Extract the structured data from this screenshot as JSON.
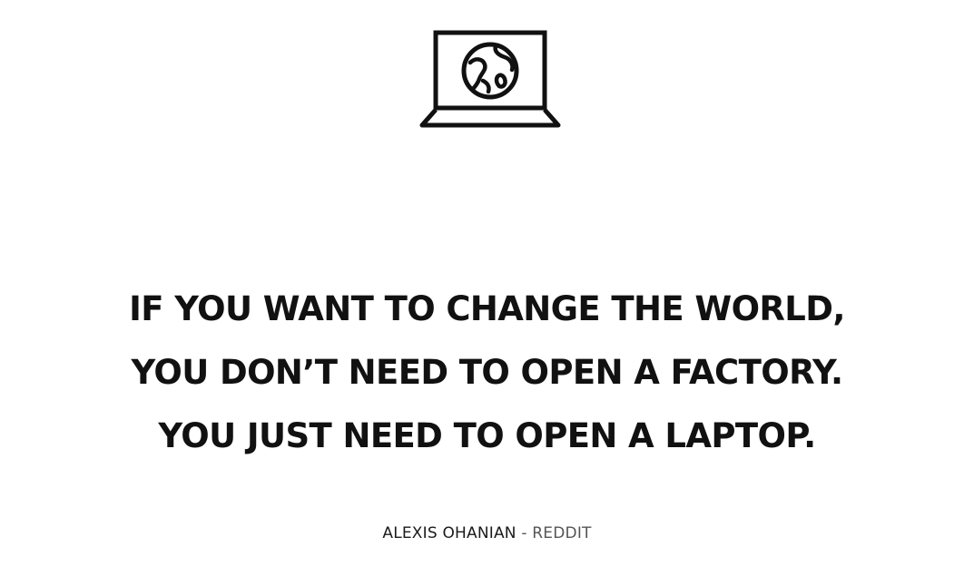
{
  "quote": {
    "lines": [
      "IF YOU WANT TO CHANGE THE WORLD,",
      "YOU DON’T NEED TO OPEN A FACTORY.",
      "YOU JUST NEED TO OPEN A LAPTOP."
    ]
  },
  "attribution": {
    "author": "ALEXIS OHANIAN",
    "separator": " - ",
    "source": "REDDIT"
  },
  "icon": {
    "name": "laptop-globe-icon",
    "color": "#111111"
  }
}
